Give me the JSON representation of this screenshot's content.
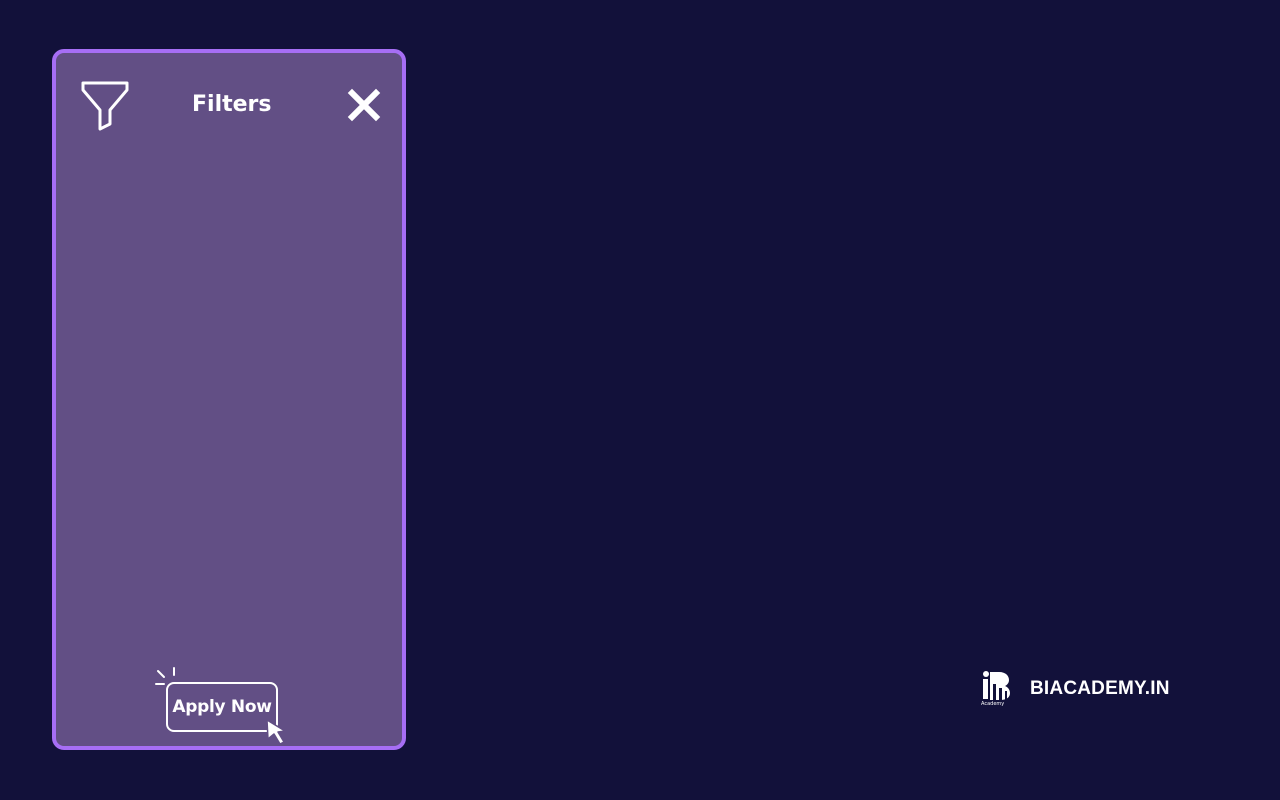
{
  "colors": {
    "background": "#12113a",
    "panel_fill": "#624f85",
    "panel_border": "#a66ef5",
    "foreground": "#ffffff"
  },
  "filter_panel": {
    "title": "Filters",
    "header_icon": "funnel-icon",
    "close_icon": "close-icon",
    "apply_button": {
      "label": "Apply Now",
      "icons": [
        "click-burst-icon",
        "cursor-icon"
      ]
    }
  },
  "brand": {
    "logo_icon": "biacademy-logo",
    "logo_caption": "Academy",
    "name": "BIACADEMY.IN"
  }
}
